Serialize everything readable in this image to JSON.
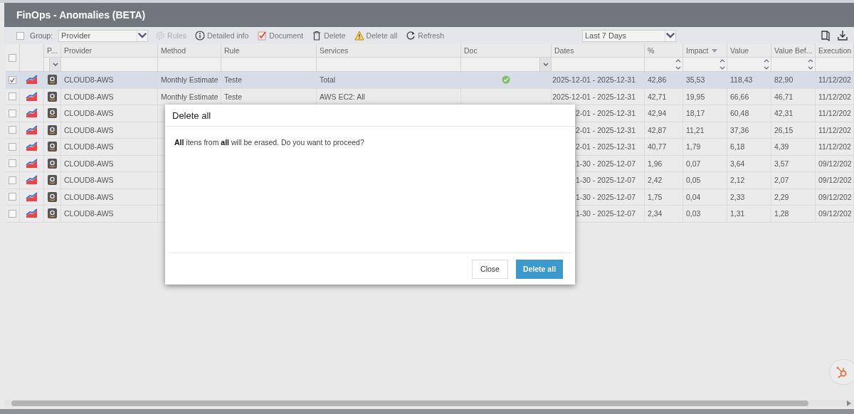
{
  "window": {
    "title": "FinOps - Anomalies (BETA)"
  },
  "toolbar": {
    "group_checked": false,
    "group_label": "Group:",
    "group_value": "Provider",
    "period_value": "Last 7 Days",
    "actions": [
      {
        "kind": "gear",
        "label": "Rules",
        "disabled": true
      },
      {
        "kind": "info",
        "label": "Detailed info",
        "disabled": false
      },
      {
        "kind": "document",
        "label": "Document",
        "disabled": false
      },
      {
        "kind": "trash",
        "label": "Delete",
        "disabled": false
      },
      {
        "kind": "warning",
        "label": "Delete all",
        "disabled": false
      },
      {
        "kind": "refresh",
        "label": "Refresh",
        "disabled": false
      }
    ]
  },
  "table": {
    "all_checked": false,
    "columns": [
      {
        "label": "P...",
        "has_dropdown": true
      },
      {
        "label": "Provider"
      },
      {
        "label": "Method"
      },
      {
        "label": "Rule"
      },
      {
        "label": "Services"
      },
      {
        "label": "Doc",
        "has_dropdown": true
      },
      {
        "label": "Dates"
      },
      {
        "label": "%",
        "has_spinner": true
      },
      {
        "label": "Impact",
        "has_spinner": true,
        "sorted_desc": true
      },
      {
        "label": "Value",
        "has_spinner": true
      },
      {
        "label": "Value Bef...",
        "has_spinner": true
      },
      {
        "label": "Execution"
      }
    ],
    "rows": [
      {
        "checked": true,
        "selected": true,
        "provider": "CLOUD8-AWS",
        "method": "Monthly Estimate",
        "rule": "Teste",
        "services": "Total",
        "doc": true,
        "dates": "2025-12-01 - 2025-12-31",
        "pct": "42,86",
        "impact": "35,53",
        "value": "118,43",
        "value_before": "82,90",
        "execution": "11/12/202"
      },
      {
        "checked": false,
        "selected": false,
        "provider": "CLOUD8-AWS",
        "method": "Monthly Estimate",
        "rule": "Teste",
        "services": "AWS EC2: All",
        "doc": false,
        "dates": "2025-12-01 - 2025-12-31",
        "pct": "42,71",
        "impact": "19,95",
        "value": "66,66",
        "value_before": "46,71",
        "execution": "11/12/202"
      },
      {
        "checked": false,
        "selected": false,
        "provider": "CLOUD8-AWS",
        "dates": "2-01 - 2025-12-31",
        "pct": "42,94",
        "impact": "18,17",
        "value": "60,48",
        "value_before": "42,31",
        "execution": "11/12/202"
      },
      {
        "checked": false,
        "selected": false,
        "provider": "CLOUD8-AWS",
        "dates": "2-01 - 2025-12-31",
        "pct": "42,87",
        "impact": "11,21",
        "value": "37,36",
        "value_before": "26,15",
        "execution": "11/12/202"
      },
      {
        "checked": false,
        "selected": false,
        "provider": "CLOUD8-AWS",
        "dates": "2-01 - 2025-12-31",
        "pct": "40,77",
        "impact": "1,79",
        "value": "6,18",
        "value_before": "4,39",
        "execution": "11/12/202"
      },
      {
        "checked": false,
        "selected": false,
        "provider": "CLOUD8-AWS",
        "dates": "1-30 - 2025-12-07",
        "pct": "1,96",
        "impact": "0,07",
        "value": "3,64",
        "value_before": "3,57",
        "execution": "09/12/202"
      },
      {
        "checked": false,
        "selected": false,
        "provider": "CLOUD8-AWS",
        "dates": "1-30 - 2025-12-07",
        "pct": "2,42",
        "impact": "0,05",
        "value": "2,12",
        "value_before": "2,07",
        "execution": "09/12/202"
      },
      {
        "checked": false,
        "selected": false,
        "provider": "CLOUD8-AWS",
        "dates": "1-30 - 2025-12-07",
        "pct": "1,75",
        "impact": "0,04",
        "value": "2,33",
        "value_before": "2,29",
        "execution": "09/12/202"
      },
      {
        "checked": false,
        "selected": false,
        "provider": "CLOUD8-AWS",
        "dates": "1-30 - 2025-12-07",
        "pct": "2,34",
        "impact": "0,03",
        "value": "1,31",
        "value_before": "1,28",
        "execution": "09/12/202"
      }
    ]
  },
  "dialog": {
    "title": "Delete all",
    "message": "**All** itens from **all** will be erased. Do you want to proceed?",
    "buttons": [
      {
        "label": "Close",
        "kind": "secondary"
      },
      {
        "label": "Delete all",
        "kind": "primary"
      }
    ]
  }
}
